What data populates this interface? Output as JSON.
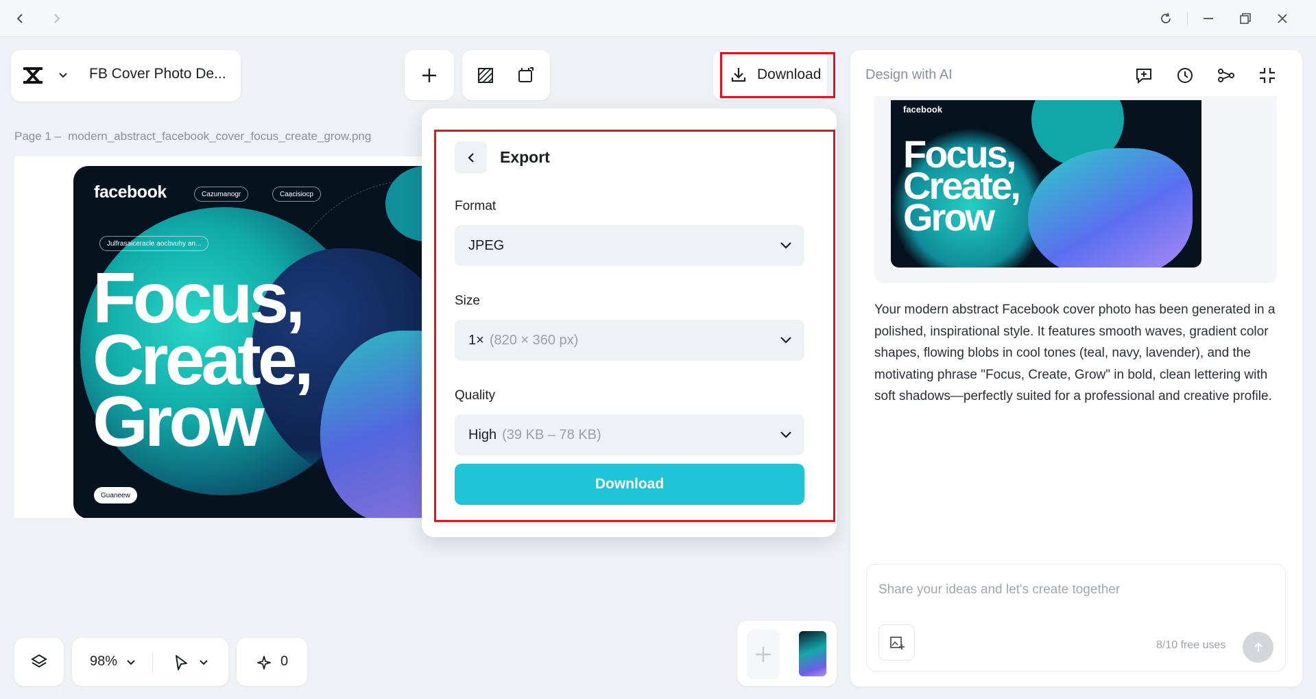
{
  "project": {
    "title": "FB Cover Photo De..."
  },
  "toolbar": {
    "download_label": "Download"
  },
  "page": {
    "prefix": "Page 1 –",
    "filename": "modern_abstract_facebook_cover_focus_create_grow.png"
  },
  "cover": {
    "logo": "facebook",
    "pill1": "Cazumanogr",
    "pill2": "Caạcisiocp",
    "pill3": "Julfrasaiceracle aocbvuhy an...",
    "headline_1": "Focus,",
    "headline_2": "Create,",
    "headline_3": "Grow",
    "button": "Guaneew"
  },
  "export": {
    "title": "Export",
    "format_label": "Format",
    "format_value": "JPEG",
    "size_label": "Size",
    "size_value": "1×",
    "size_detail": "(820 × 360 px)",
    "quality_label": "Quality",
    "quality_value": "High",
    "quality_detail": "(39 KB – 78 KB)",
    "download_label": "Download"
  },
  "ai": {
    "title": "Design with AI",
    "preview_logo": "facebook",
    "preview_headline_1": "Focus,",
    "preview_headline_2": "Create,",
    "preview_headline_3": "Grow",
    "description": "Your modern abstract Facebook cover photo has been generated in a polished, inspirational style. It features smooth waves, gradient color shapes, flowing blobs in cool tones (teal, navy, lavender), and the motivating phrase \"Focus, Create, Grow\" in bold, clean lettering with soft shadows—perfectly suited for a professional and creative profile.",
    "input_placeholder": "Share your ideas and let's create together",
    "free_uses": "8/10 free uses"
  },
  "bottom": {
    "zoom": "98%",
    "count": "0"
  },
  "colors": {
    "accent": "#1fc5d6",
    "highlight": "#e0121b",
    "background": "#eef1f5"
  }
}
